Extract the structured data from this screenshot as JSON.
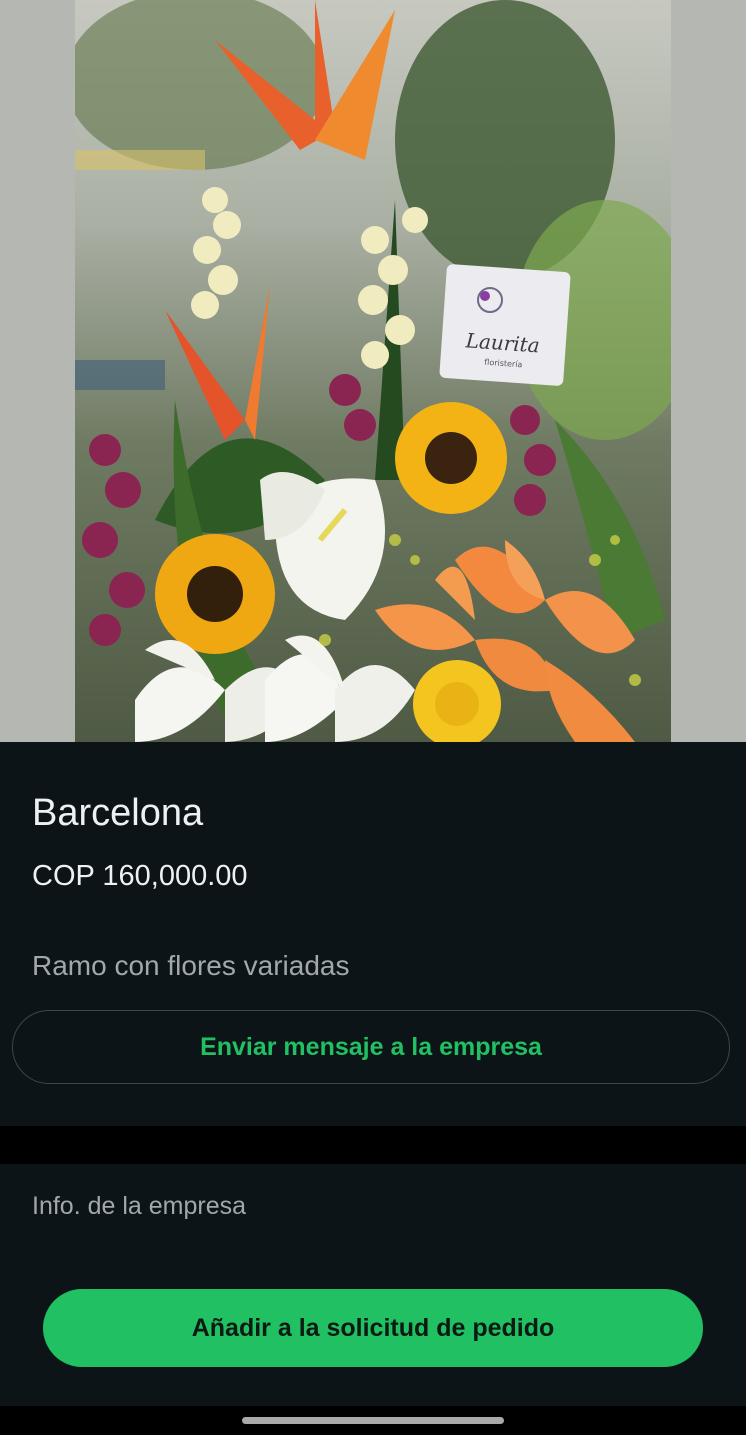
{
  "product": {
    "image_alt": "flower-arrangement",
    "card_text": "Laurita",
    "card_subtext": "floristería",
    "name": "Barcelona",
    "price": "COP 160,000.00",
    "description": "Ramo con flores variadas",
    "message_button": "Enviar mensaje a la empresa"
  },
  "company": {
    "info_label": "Info. de la empresa",
    "add_button": "Añadir a la solicitud de pedido"
  },
  "colors": {
    "accent": "#21c063",
    "background": "#0d1418",
    "text_primary": "#eef1f2",
    "text_secondary": "#a1a8ad"
  }
}
